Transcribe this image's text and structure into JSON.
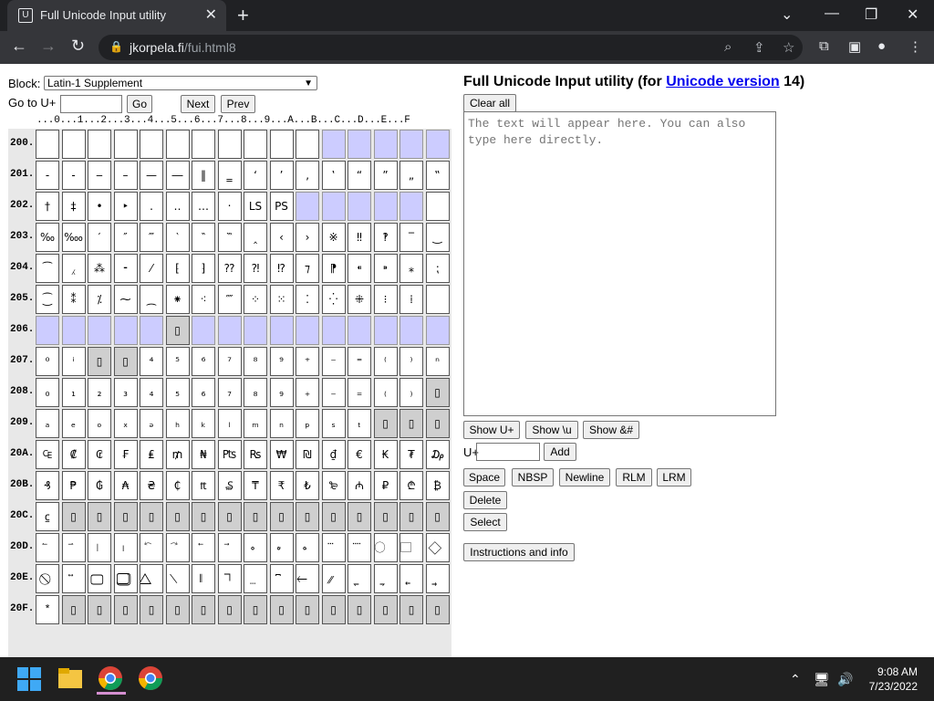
{
  "browser": {
    "tab_title": "Full Unicode Input utility",
    "url_host": "jkorpela.fi",
    "url_path": "/fui.html8"
  },
  "page": {
    "block_label": "Block:",
    "block_value": "Latin-1 Supplement",
    "goto_label": "Go to U+",
    "go_btn": "Go",
    "next_btn": "Next",
    "prev_btn": "Prev",
    "col_header": "...0...1...2...3...4...5...6...7...8...9...A...B...C...D...E...F",
    "title_prefix": "Full Unicode Input utility (for ",
    "title_link": "Unicode version",
    "title_suffix": " 14)",
    "clear_btn": "Clear all",
    "textarea_placeholder": "The text will appear here. You can also type here directly.",
    "show_uplus": "Show U+",
    "show_u": "Show \\u",
    "show_amp": "Show &#",
    "uplus_label": "U+",
    "add_btn": "Add",
    "space_btn": "Space",
    "nbsp_btn": "NBSP",
    "newline_btn": "Newline",
    "rlm_btn": "RLM",
    "lrm_btn": "LRM",
    "delete_btn": "Delete",
    "select_btn": "Select",
    "instructions_btn": "Instructions and info"
  },
  "grid": {
    "rows": [
      {
        "label": "200.",
        "cells": [
          "",
          "",
          "",
          "",
          "",
          "",
          "",
          "",
          "",
          "",
          "",
          "u",
          "u",
          "u",
          "u",
          "u"
        ]
      },
      {
        "label": "201.",
        "cells": [
          "‐",
          "‑",
          "‒",
          "–",
          "—",
          "―",
          "‖",
          "‗",
          "‘",
          "’",
          "‚",
          "‛",
          "“",
          "”",
          "„",
          "‟"
        ]
      },
      {
        "label": "202.",
        "cells": [
          "†",
          "‡",
          "•",
          "‣",
          "․",
          "‥",
          "…",
          "‧",
          "LS",
          "PS",
          "u",
          "u",
          "u",
          "u",
          "u",
          ""
        ]
      },
      {
        "label": "203.",
        "cells": [
          "‰",
          "‱",
          "′",
          "″",
          "‴",
          "‵",
          "‶",
          "‷",
          "‸",
          "‹",
          "›",
          "※",
          "‼",
          "‽",
          "‾",
          "‿"
        ]
      },
      {
        "label": "204.",
        "cells": [
          "⁀",
          "⁁",
          "⁂",
          "⁃",
          "⁄",
          "⁅",
          "⁆",
          "⁇",
          "⁈",
          "⁉",
          "⁊",
          "⁋",
          "⁌",
          "⁍",
          "⁎",
          "⁏"
        ]
      },
      {
        "label": "205.",
        "cells": [
          "⁐",
          "⁑",
          "⁒",
          "⁓",
          "⁔",
          "⁕",
          "⁖",
          "⁗",
          "⁘",
          "⁙",
          "⁚",
          "⁛",
          "⁜",
          "⁝",
          "⁞",
          ""
        ]
      },
      {
        "label": "206.",
        "cells": [
          "u",
          "u",
          "u",
          "u",
          "u",
          "d",
          "u",
          "u",
          "u",
          "u",
          "u",
          "u",
          "u",
          "u",
          "u",
          "u"
        ]
      },
      {
        "label": "207.",
        "cells": [
          "⁰",
          "ⁱ",
          "d",
          "d",
          "⁴",
          "⁵",
          "⁶",
          "⁷",
          "⁸",
          "⁹",
          "⁺",
          "⁻",
          "⁼",
          "⁽",
          "⁾",
          "ⁿ"
        ]
      },
      {
        "label": "208.",
        "cells": [
          "₀",
          "₁",
          "₂",
          "₃",
          "₄",
          "₅",
          "₆",
          "₇",
          "₈",
          "₉",
          "₊",
          "₋",
          "₌",
          "₍",
          "₎",
          "d"
        ]
      },
      {
        "label": "209.",
        "cells": [
          "ₐ",
          "ₑ",
          "ₒ",
          "ₓ",
          "ₔ",
          "ₕ",
          "ₖ",
          "ₗ",
          "ₘ",
          "ₙ",
          "ₚ",
          "ₛ",
          "ₜ",
          "d",
          "d",
          "d"
        ]
      },
      {
        "label": "20A.",
        "cells": [
          "₠",
          "₡",
          "₢",
          "₣",
          "₤",
          "₥",
          "₦",
          "₧",
          "₨",
          "₩",
          "₪",
          "₫",
          "€",
          "₭",
          "₮",
          "₯"
        ]
      },
      {
        "label": "20B.",
        "cells": [
          "₰",
          "₱",
          "₲",
          "₳",
          "₴",
          "₵",
          "₶",
          "₷",
          "₸",
          "₹",
          "₺",
          "₻",
          "₼",
          "₽",
          "₾",
          "₿"
        ]
      },
      {
        "label": "20C.",
        "cells": [
          "⃀",
          "d",
          "d",
          "d",
          "d",
          "d",
          "d",
          "d",
          "d",
          "d",
          "d",
          "d",
          "d",
          "d",
          "d",
          "d"
        ]
      },
      {
        "label": "20D.",
        "cells": [
          "⃐",
          "⃑",
          "⃒",
          "⃓",
          "⃔",
          "⃕",
          "⃖",
          "⃗",
          "⃘",
          "⃙",
          "⃚",
          "⃛",
          "⃜",
          "⃝",
          "⃞",
          "⃟"
        ]
      },
      {
        "label": "20E.",
        "cells": [
          "⃠",
          "⃡",
          "⃢",
          "⃣",
          "⃤",
          "⃥",
          "⃦",
          "⃧",
          "⃨",
          "⃩",
          "⃪",
          "⃫",
          "⃬",
          "⃭",
          "⃮",
          "⃯"
        ]
      },
      {
        "label": "20F.",
        "cells": [
          "⃰",
          "d",
          "d",
          "d",
          "d",
          "d",
          "d",
          "d",
          "d",
          "d",
          "d",
          "d",
          "d",
          "d",
          "d",
          "d"
        ]
      }
    ]
  },
  "taskbar": {
    "time": "9:08 AM",
    "date": "7/23/2022"
  },
  "colors": {
    "unassigned": "#ccccff",
    "disabled": "#cfcfcf",
    "link": "#0000ee"
  }
}
